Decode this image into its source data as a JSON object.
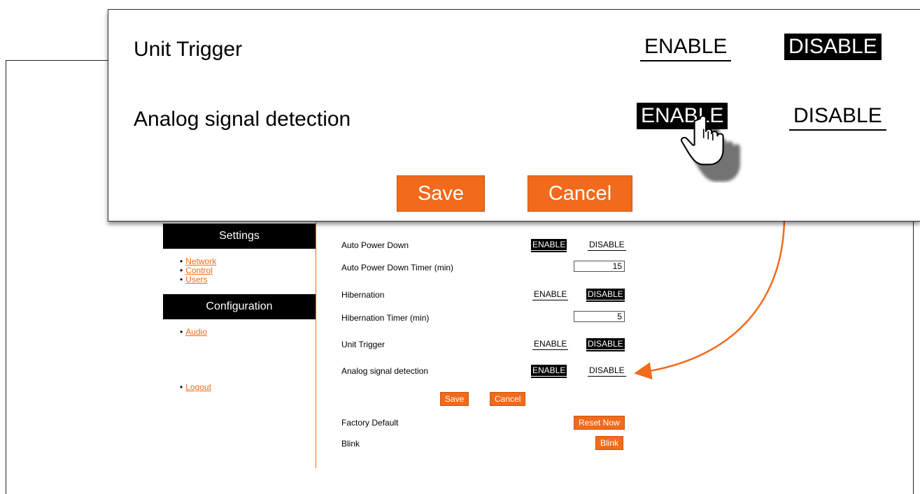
{
  "sidebar": {
    "settings_title": "Settings",
    "settings_links": [
      "Network",
      "Control",
      "Users"
    ],
    "config_title": "Configuration",
    "config_links": [
      "Audio"
    ],
    "logout": "Logout"
  },
  "rows": {
    "auto_power_down": {
      "label": "Auto Power Down",
      "enable": "ENABLE",
      "disable": "DISABLE",
      "selected": "ENABLE"
    },
    "auto_power_down_timer": {
      "label": "Auto Power Down Timer (min)",
      "value": "15"
    },
    "hibernation": {
      "label": "Hibernation",
      "enable": "ENABLE",
      "disable": "DISABLE",
      "selected": "DISABLE"
    },
    "hibernation_timer": {
      "label": "Hibernation Timer (min)",
      "value": "5"
    },
    "unit_trigger": {
      "label": "Unit Trigger",
      "enable": "ENABLE",
      "disable": "DISABLE",
      "selected": "DISABLE"
    },
    "analog_signal": {
      "label": "Analog signal detection",
      "enable": "ENABLE",
      "disable": "DISABLE",
      "selected": "ENABLE"
    }
  },
  "buttons": {
    "save": "Save",
    "cancel": "Cancel",
    "reset_now": "Reset Now",
    "blink": "Blink"
  },
  "extra_rows": {
    "factory_default": "Factory Default",
    "blink": "Blink"
  },
  "colors": {
    "accent": "#f26a1b",
    "active_bg": "#000000"
  },
  "icons": {
    "cursor": "pointer-hand-icon",
    "callout_arrow": "curved-arrow-icon"
  }
}
